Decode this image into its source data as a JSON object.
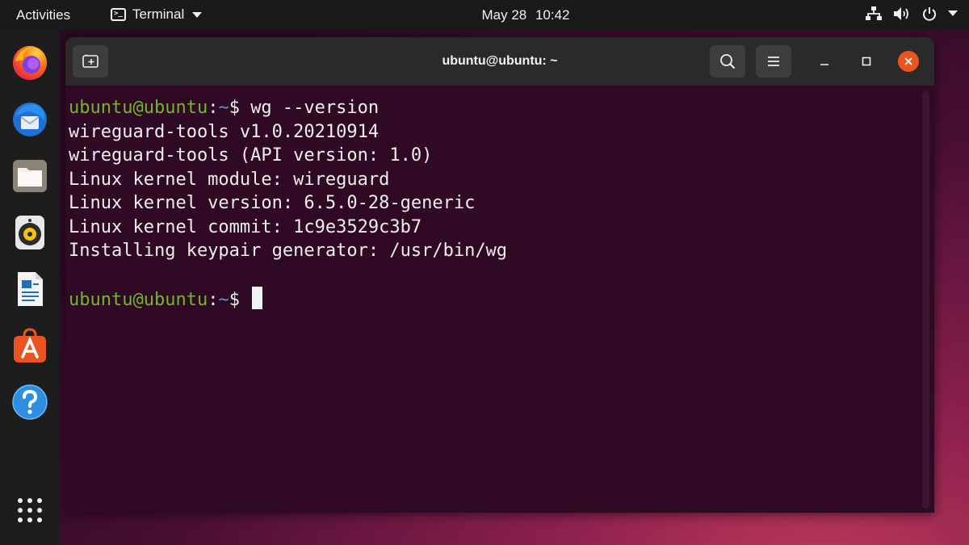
{
  "topbar": {
    "activities": "Activities",
    "app_name": "Terminal",
    "date": "May 28",
    "time": "10:42"
  },
  "dock": {
    "items": [
      "firefox-icon",
      "thunderbird-icon",
      "files-icon",
      "rhythmbox-icon",
      "libreoffice-writer-icon",
      "ubuntu-software-icon",
      "help-icon"
    ],
    "apps_grid": "show-applications-icon"
  },
  "window": {
    "title": "ubuntu@ubuntu: ~",
    "buttons": [
      "new-tab-icon",
      "search-icon",
      "hamburger-menu-icon",
      "minimize-icon",
      "maximize-icon",
      "close-icon"
    ],
    "close_color": "#e95420"
  },
  "terminal": {
    "prompt_user": "ubuntu@ubuntu",
    "prompt_colon": ":",
    "prompt_path": "~",
    "prompt_symbol": "$ ",
    "command": "wg --version",
    "output": [
      "wireguard-tools v1.0.20210914",
      "wireguard-tools (API version: 1.0)",
      "Linux kernel module: wireguard",
      "Linux kernel version: 6.5.0-28-generic",
      "Linux kernel commit: 1c9e3529c3b7",
      "Installing keypair generator: /usr/bin/wg"
    ],
    "colors": {
      "background": "#300a24",
      "user": "#73b530",
      "path": "#6f8fc9",
      "text": "#eeeeec"
    }
  }
}
